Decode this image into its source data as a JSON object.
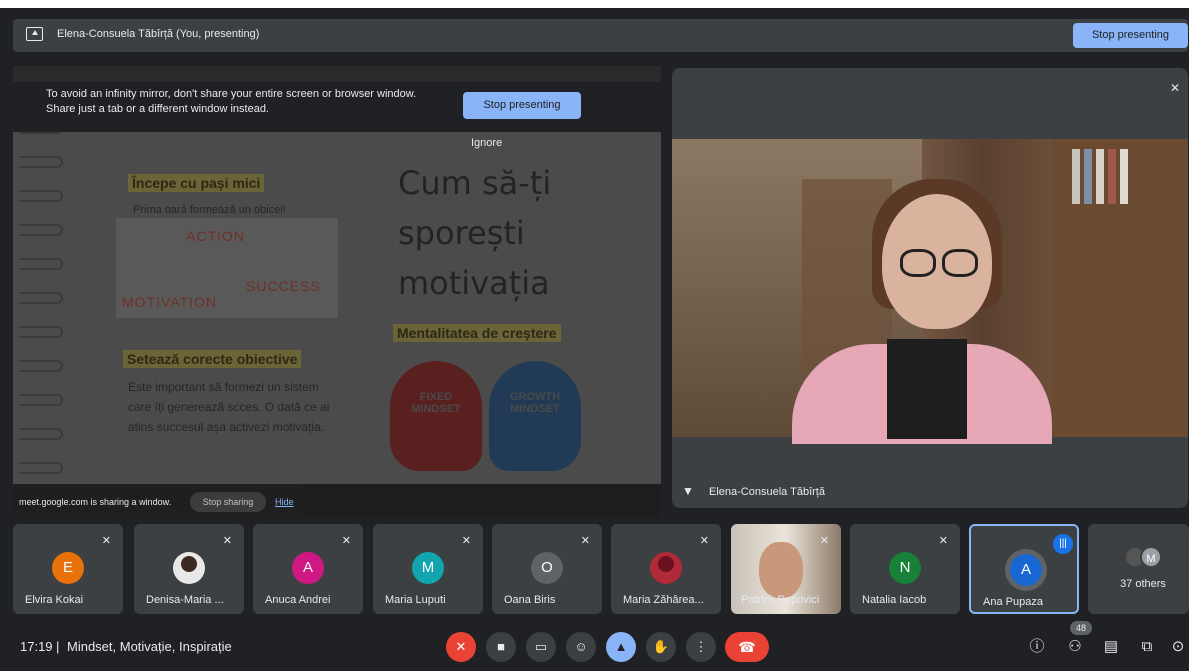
{
  "banner": {
    "presenter_label": "Elena-Consuela Tăbîrță (You, presenting)",
    "stop_button": "Stop presenting"
  },
  "warning": {
    "line1": "To avoid an infinity mirror, don't share your entire screen or browser window.",
    "line2": "Share just a tab or a different window instead.",
    "stop_button": "Stop presenting",
    "ignore_button": "Ignore"
  },
  "slide": {
    "heading1": "Începe cu pași mici",
    "text1": "Prima oară formează un obicei!",
    "arrow_words": [
      "ACTION",
      "SUCCESS",
      "MOTIVATION"
    ],
    "title_lines": [
      "Cum să-ți",
      "sporești",
      "motivația"
    ],
    "heading2": "Setează corecte obiective",
    "body_lines": [
      "Este important să formezi un sistem",
      "care îți generează scces. O dată ce ai",
      "atins succesul așa activezi motivația."
    ],
    "heading3": "Mentalitatea de creștere",
    "fixed_label": "FIXED MINDSET",
    "growth_label": "GROWTH MINDSET"
  },
  "share_bar": {
    "text": "meet.google.com is sharing a window.",
    "stop_button": "Stop sharing",
    "hide_link": "Hide"
  },
  "presenter": {
    "name": "Elena-Consuela Tăbîrță"
  },
  "participants": [
    {
      "name": "Elvira Kokai",
      "initial": "E",
      "color": "#e8710a"
    },
    {
      "name": "Denisa-Maria ...",
      "initial": "",
      "color": "#e8e8e8"
    },
    {
      "name": "Anuca Andrei",
      "initial": "A",
      "color": "#d01884"
    },
    {
      "name": "Maria Luputi",
      "initial": "M",
      "color": "#12a4af"
    },
    {
      "name": "Oana Biris",
      "initial": "O",
      "color": "#5f6368"
    },
    {
      "name": "Maria Zăhârea...",
      "initial": "",
      "color": "#b02a3a"
    },
    {
      "name": "Patrick Popovici",
      "initial": "",
      "color": "#a89080"
    },
    {
      "name": "Natalia Iacob",
      "initial": "N",
      "color": "#188038"
    },
    {
      "name": "Ana Pupaza",
      "initial": "A",
      "color": "#1967d2"
    }
  ],
  "others": {
    "avatar_initial": "M",
    "label": "37 others"
  },
  "bottom": {
    "time": "17:19",
    "separator": "|",
    "meeting_title": "Mindset, Motivație, Inspirație",
    "people_count": "48"
  }
}
